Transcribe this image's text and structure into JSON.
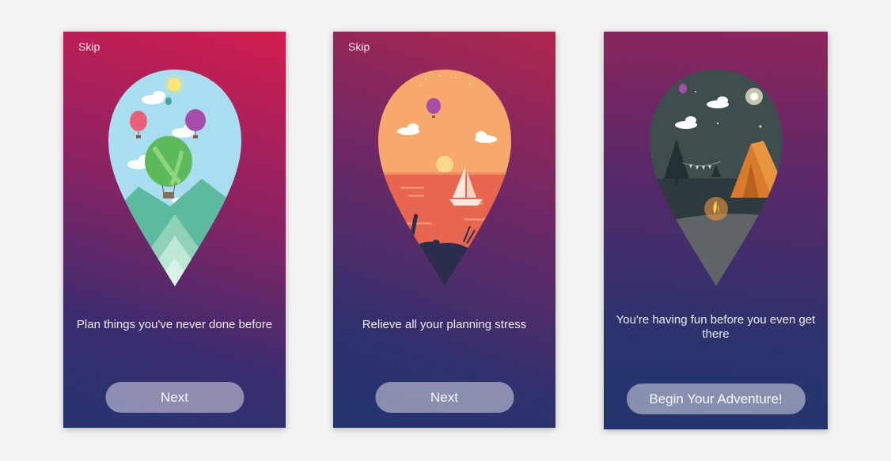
{
  "screens": [
    {
      "skip_label": "Skip",
      "caption": "Plan things you've never done before",
      "button_label": "Next"
    },
    {
      "skip_label": "Skip",
      "caption": "Relieve all your planning stress",
      "button_label": "Next"
    },
    {
      "caption": "You're having fun before you even get there",
      "button_label": "Begin Your Adventure!"
    }
  ],
  "colors": {
    "pin1_sky": "#a9def1",
    "pin2_sky": "#f7a86c",
    "pin3_sky": "#3e4d4e"
  }
}
